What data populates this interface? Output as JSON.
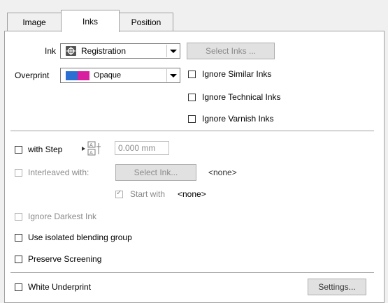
{
  "tabs": [
    {
      "label": "Image"
    },
    {
      "label": "Inks"
    },
    {
      "label": "Position"
    }
  ],
  "ink": {
    "label": "Ink",
    "value": "Registration",
    "icon": "registration-icon",
    "select_button": "Select Inks ..."
  },
  "overprint": {
    "label": "Overprint",
    "value": "Opaque",
    "swatch_colors": [
      "#2a6fd1",
      "#d81fa0"
    ]
  },
  "ignore_options": {
    "similar": "Ignore Similar Inks",
    "technical": "Ignore Technical Inks",
    "varnish": "Ignore Varnish Inks"
  },
  "step": {
    "label": "with Step",
    "value": "0.000 mm"
  },
  "interleaved": {
    "label": "Interleaved with:",
    "select_button": "Select Ink...",
    "value": "<none>",
    "start_with_label": "Start with",
    "start_with_value": "<none>"
  },
  "options": {
    "ignore_darkest": "Ignore Darkest Ink",
    "isolated_blending": "Use isolated blending group",
    "preserve_screening": "Preserve Screening"
  },
  "white_underprint": {
    "label": "White Underprint",
    "settings_button": "Settings..."
  }
}
